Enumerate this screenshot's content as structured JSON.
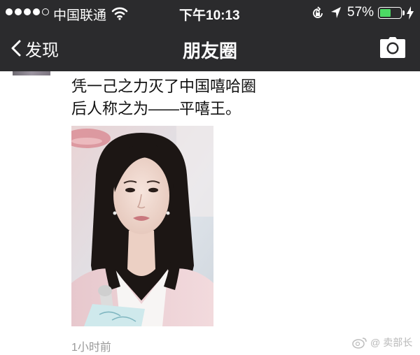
{
  "status_bar": {
    "carrier": "中国联通",
    "time": "下午10:13",
    "battery": "57%",
    "battery_level": 0.57,
    "signal_bars": 4,
    "signal_total": 5
  },
  "nav": {
    "back_label": "发现",
    "title": "朋友圈"
  },
  "post": {
    "lines": [
      "凭一己之力灭了中国嘻哈圈",
      "后人称之为——平嘻王。"
    ],
    "time_ago": "1小时前"
  },
  "watermark": {
    "text": "卖部长"
  },
  "colors": {
    "bar_bg": "#2b2b2d",
    "battery_green": "#4cd964",
    "timestamp_gray": "#999999"
  }
}
